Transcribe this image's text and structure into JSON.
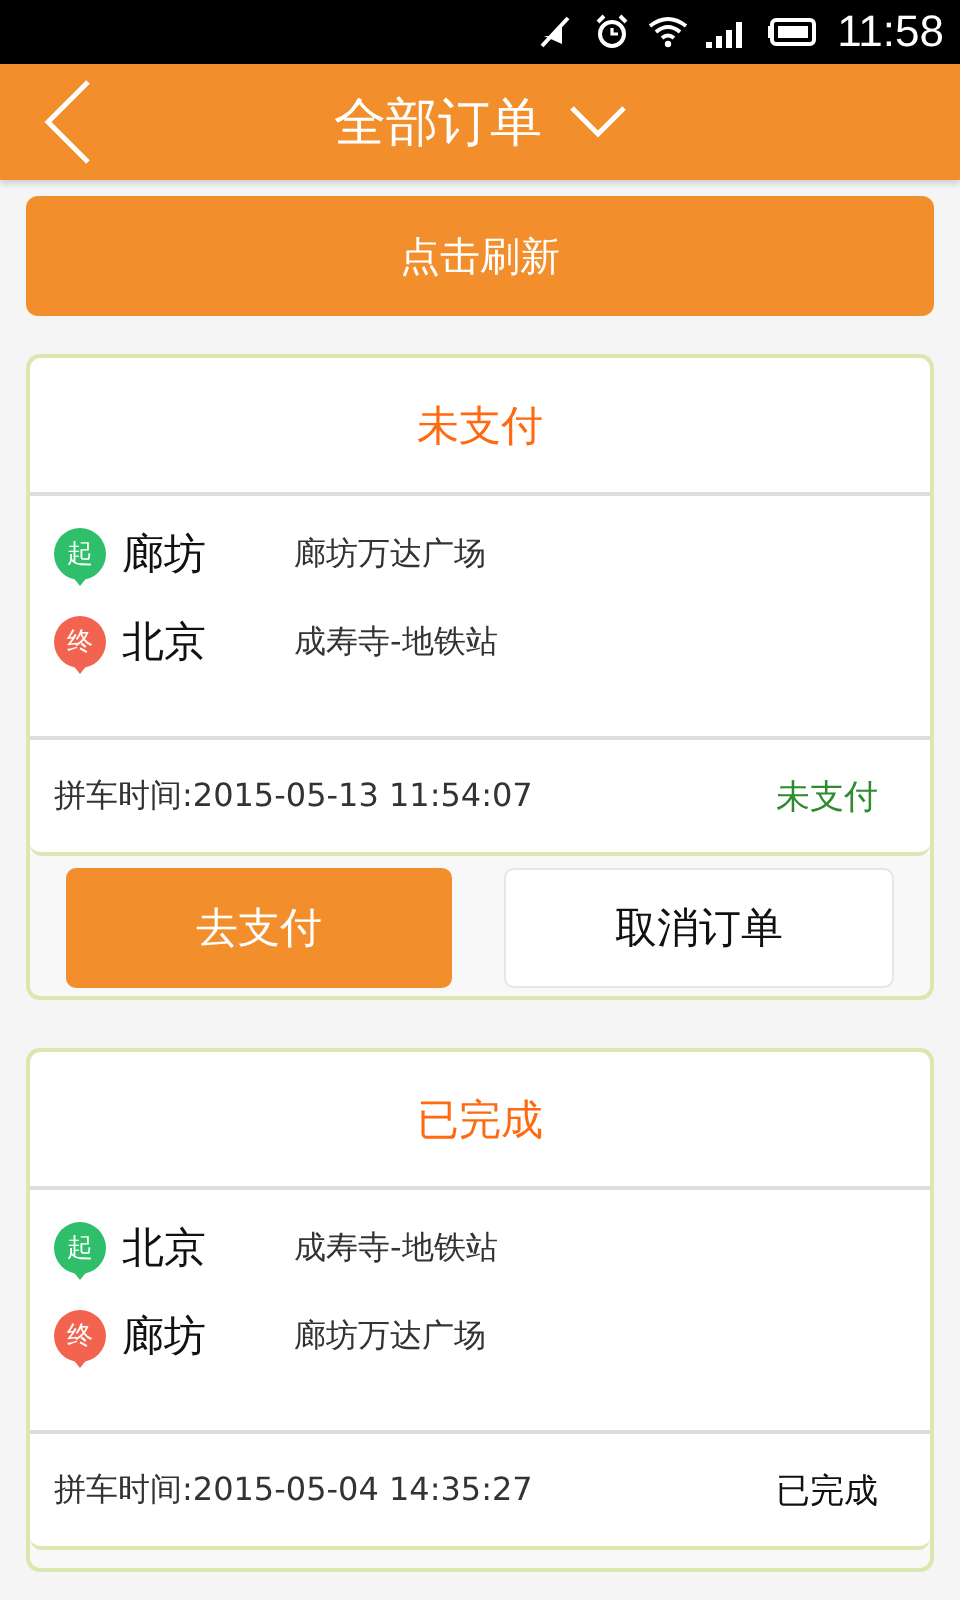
{
  "status_bar": {
    "time": "11:58"
  },
  "header": {
    "title": "全部订单"
  },
  "refresh_button": "点击刷新",
  "orders": [
    {
      "status": "未支付",
      "stops": [
        {
          "kind": "start",
          "marker": "起",
          "city": "廊坊",
          "place": "廊坊万达广场"
        },
        {
          "kind": "end",
          "marker": "终",
          "city": "北京",
          "place": "成寿寺-地铁站"
        }
      ],
      "time": "拼车时间:2015-05-13 11:54:07",
      "footer_status": "未支付",
      "color": "#2e8b2e",
      "buttons": [
        {
          "label": "去支付",
          "kind": "primary"
        },
        {
          "label": "取消订单",
          "kind": "secondary"
        }
      ]
    },
    {
      "status": "已完成",
      "stops": [
        {
          "kind": "start",
          "marker": "起",
          "city": "北京",
          "place": "成寿寺-地铁站"
        },
        {
          "kind": "end",
          "marker": "终",
          "city": "廊坊",
          "place": "廊坊万达广场"
        }
      ],
      "time": "拼车时间:2015-05-04 14:35:27",
      "footer_status": "已完成",
      "color": "#111111"
    }
  ]
}
